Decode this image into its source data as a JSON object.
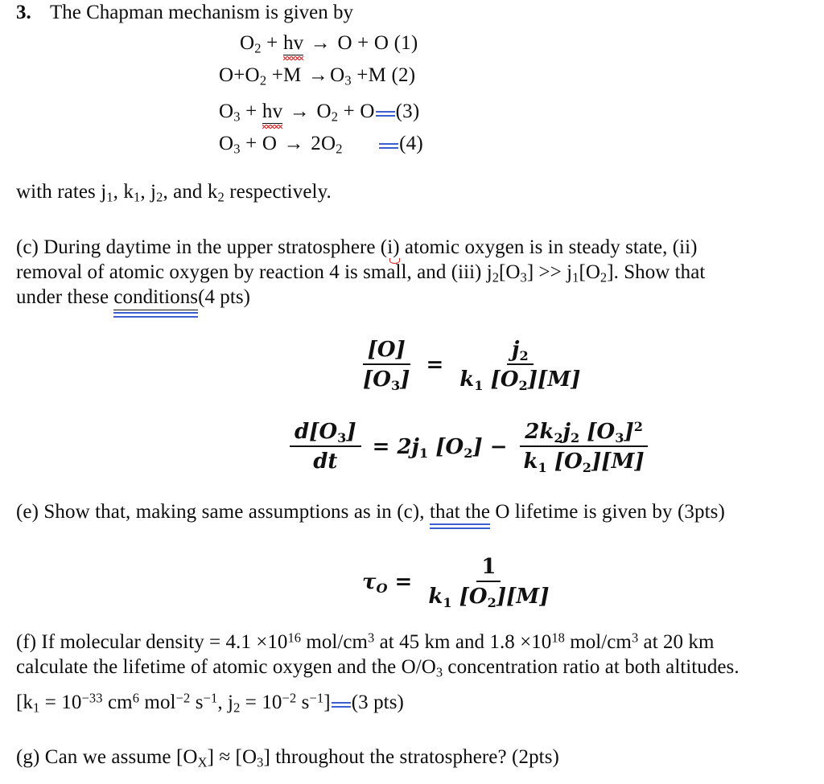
{
  "problem": {
    "number": "3.",
    "title": "The Chapman mechanism is given by"
  },
  "reactions": [
    {
      "id": "reaction-1",
      "lhs_species": "O",
      "lhs_sub": "2",
      "plus": "+",
      "photon": "hv",
      "arrow": "→",
      "rhs": "O + O",
      "label": "(1)"
    },
    {
      "id": "reaction-2",
      "text_a": "O+O",
      "sub_a": "2",
      "text_b": " +M ",
      "arrow": "→",
      "text_c": "O",
      "sub_c": "3",
      "text_d": " +M",
      "label": "(2)"
    },
    {
      "id": "reaction-3",
      "text_a": "O",
      "sub_a": "3",
      "plus": " + ",
      "photon": "hv",
      "arrow": "→",
      "text_c": "O",
      "sub_c": "2",
      "text_d": " + O",
      "label": "(3)"
    },
    {
      "id": "reaction-4",
      "text_a": "O",
      "sub_a": "3",
      "plus": " + O ",
      "arrow": "→",
      "text_c": " 2O",
      "sub_c": "2",
      "label": "(4)"
    }
  ],
  "rates_line": {
    "prefix": "with rates j",
    "sub1": "1",
    "mid1": ", k",
    "sub2": "1",
    "mid2": ", j",
    "sub3": "2",
    "mid3": ", and k",
    "sub4": "2",
    "suffix": " respectively."
  },
  "part_c": {
    "seg1": "(c) During daytime in the upper stratosphere (",
    "roman_i": "i",
    "seg2": ") atomic oxygen is in steady state, (ii)",
    "seg3": "removal of atomic oxygen by reaction 4 is small, and (iii) j",
    "sub_j2": "2",
    "seg4": "[O",
    "sub_o3": "3",
    "seg5": "] >> j",
    "sub_j1": "1",
    "seg6": "[O",
    "sub_o2": "2",
    "seg7": "]. Show that",
    "seg8": "under these ",
    "underlined": "conditions ",
    "seg9": "(4 pts)"
  },
  "equation_ratio": {
    "name": "steady-state-ratio",
    "lhs_num": "[O]",
    "lhs_den_base": "[O",
    "lhs_den_sub": "3",
    "lhs_den_tail": "]",
    "equals": "=",
    "rhs_num_base": "j",
    "rhs_num_sub": "2",
    "rhs_den_k": "k",
    "rhs_den_k_sub": "1",
    "rhs_den_o2": " [O",
    "rhs_den_o2_sub": "2",
    "rhs_den_tail": "][M]"
  },
  "equation_rate": {
    "name": "ozone-rate-equation",
    "lhs_num_d": "d[O",
    "lhs_num_sub": "3",
    "lhs_num_tail": "]",
    "lhs_den": "dt",
    "equals": "=",
    "term1_coeff": "2j",
    "term1_sub": "1",
    "term1_tail": " [O",
    "term1_tail_sub": "2",
    "term1_end": "]",
    "minus": "−",
    "frac_num_a": "2k",
    "frac_num_a_sub": "2",
    "frac_num_b": "j",
    "frac_num_b_sub": "2",
    "frac_num_c": " [O",
    "frac_num_c_sub": "3",
    "frac_num_tail": "]",
    "frac_num_pow": "2",
    "frac_den_k": "k",
    "frac_den_k_sub": "1",
    "frac_den_o2": " [O",
    "frac_den_o2_sub": "2",
    "frac_den_tail": "][M]"
  },
  "part_e": {
    "seg1": "(e) Show that, making same assumptions as in (c), ",
    "underlined": "that  the",
    "seg2": " O lifetime is given by (3pts)"
  },
  "equation_tau": {
    "name": "oxygen-lifetime-equation",
    "tau": "τ",
    "tau_sub": "O",
    "equals": "=",
    "num": "1",
    "den_k": "k",
    "den_k_sub": "1",
    "den_o2": " [O",
    "den_o2_sub": "2",
    "den_tail": "][M]"
  },
  "part_f": {
    "seg1": "(f) If molecular density = 4.1 ×10",
    "exp1": "16",
    "seg2": " mol/cm",
    "sup_cm1": "3",
    "seg3": " at 45 km and 1.8 ×10",
    "exp2": "18",
    "seg4": " mol/cm",
    "sup_cm2": "3",
    "seg5": " at 20 km",
    "seg6": "calculate the lifetime of atomic oxygen and the O/O",
    "sub_o3": "3",
    "seg7": " concentration ratio at both altitudes.",
    "const_seg1": "[k",
    "const_sub_k": "1",
    "const_seg2": " = 10",
    "const_exp1": "−33",
    "const_seg3": " cm",
    "const_sup_cm": "6",
    "const_seg4": " mol",
    "const_exp2": "−2",
    "const_seg5": " s",
    "const_exp3": "−1",
    "const_seg6": ", j",
    "const_sub_j": "2",
    "const_seg7": " = 10",
    "const_exp4": "−2",
    "const_seg8": " s",
    "const_exp5": "−1",
    "const_seg9": "]",
    "const_seg10": "(3 pts)"
  },
  "part_g": {
    "seg1": "(g) Can we assume [O",
    "sub_x": "X",
    "seg2": "] ≈ [O",
    "sub_o3": "3",
    "seg3": "] throughout the stratosphere? (2pts)"
  },
  "colors": {
    "text": "#0d0d0d",
    "spellcheck_red": "#e02020",
    "grammar_blue": "#3b5fd0"
  }
}
